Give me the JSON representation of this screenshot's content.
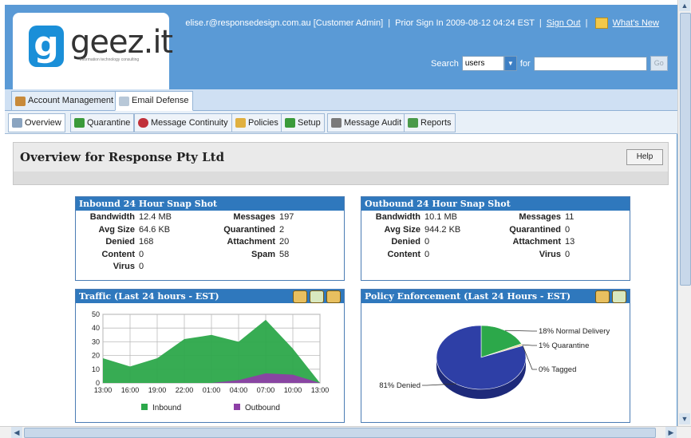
{
  "header": {
    "logo_letter": "g",
    "logo_name": "geez.it",
    "logo_tagline": "information technology consulting",
    "user_email": "elise.r@responsedesign.com.au",
    "user_role": "[Customer Admin]",
    "prior_sign_in": "Prior Sign In 2009-08-12 04:24 EST",
    "sign_out_label": "Sign Out",
    "whats_new_label": "What's New",
    "search_label": "Search",
    "search_scope": "users",
    "for_label": "for",
    "go_label": "Go"
  },
  "main_tabs": [
    {
      "label": "Account Management",
      "icon": "users-icon"
    },
    {
      "label": "Email Defense",
      "icon": "email-defense-icon"
    }
  ],
  "sub_tabs": [
    {
      "label": "Overview",
      "icon": "overview-icon"
    },
    {
      "label": "Quarantine",
      "icon": "quarantine-icon"
    },
    {
      "label": "Message Continuity",
      "icon": "continuity-icon"
    },
    {
      "label": "Policies",
      "icon": "policies-icon"
    },
    {
      "label": "Setup",
      "icon": "setup-icon"
    },
    {
      "label": "Message Audit",
      "icon": "audit-icon"
    },
    {
      "label": "Reports",
      "icon": "reports-icon"
    }
  ],
  "page": {
    "title": "Overview for Response Pty Ltd",
    "help_label": "Help"
  },
  "inbound": {
    "title": "Inbound 24 Hour Snap Shot",
    "left": [
      {
        "key": "Bandwidth",
        "value": "12.4 MB"
      },
      {
        "key": "Avg Size",
        "value": "64.6 KB"
      },
      {
        "key": "Denied",
        "value": "168"
      },
      {
        "key": "Content",
        "value": "0"
      },
      {
        "key": "Virus",
        "value": "0"
      }
    ],
    "right": [
      {
        "key": "Messages",
        "value": "197"
      },
      {
        "key": "Quarantined",
        "value": "2"
      },
      {
        "key": "Attachment",
        "value": "20"
      },
      {
        "key": "Spam",
        "value": "58"
      }
    ]
  },
  "outbound": {
    "title": "Outbound 24 Hour Snap Shot",
    "left": [
      {
        "key": "Bandwidth",
        "value": "10.1 MB"
      },
      {
        "key": "Avg Size",
        "value": "944.2 KB"
      },
      {
        "key": "Denied",
        "value": "0"
      },
      {
        "key": "Content",
        "value": "0"
      }
    ],
    "right": [
      {
        "key": "Messages",
        "value": "11"
      },
      {
        "key": "Quarantined",
        "value": "0"
      },
      {
        "key": "Attachment",
        "value": "13"
      },
      {
        "key": "Virus",
        "value": "0"
      }
    ]
  },
  "chart_data": [
    {
      "type": "area",
      "title": "Traffic (Last 24 hours - EST)",
      "categories": [
        "13:00",
        "16:00",
        "19:00",
        "22:00",
        "01:00",
        "04:00",
        "07:00",
        "10:00",
        "13:00"
      ],
      "ylim": [
        0,
        50
      ],
      "yticks": [
        0,
        10,
        20,
        30,
        40,
        50
      ],
      "grid": true,
      "legend_position": "bottom",
      "series": [
        {
          "name": "Inbound",
          "color": "#2ca84a",
          "values": [
            18,
            12,
            18,
            32,
            35,
            30,
            46,
            25,
            0
          ]
        },
        {
          "name": "Outbound",
          "color": "#8d3fa6",
          "values": [
            0,
            0,
            0,
            0,
            0,
            2,
            7,
            6,
            0
          ]
        }
      ]
    },
    {
      "type": "pie",
      "title": "Policy Enforcement (Last 24 Hours - EST)",
      "slices": [
        {
          "label": "Normal Delivery",
          "value": 18,
          "display": "18%",
          "color": "#2ca84a"
        },
        {
          "label": "Quarantine",
          "value": 1,
          "display": "1%",
          "color": "#e8d8a0"
        },
        {
          "label": "Tagged",
          "value": 0,
          "display": "0%",
          "color": "#c8c8c8"
        },
        {
          "label": "Denied",
          "value": 81,
          "display": "81%",
          "color": "#2e3fa6"
        }
      ]
    }
  ]
}
